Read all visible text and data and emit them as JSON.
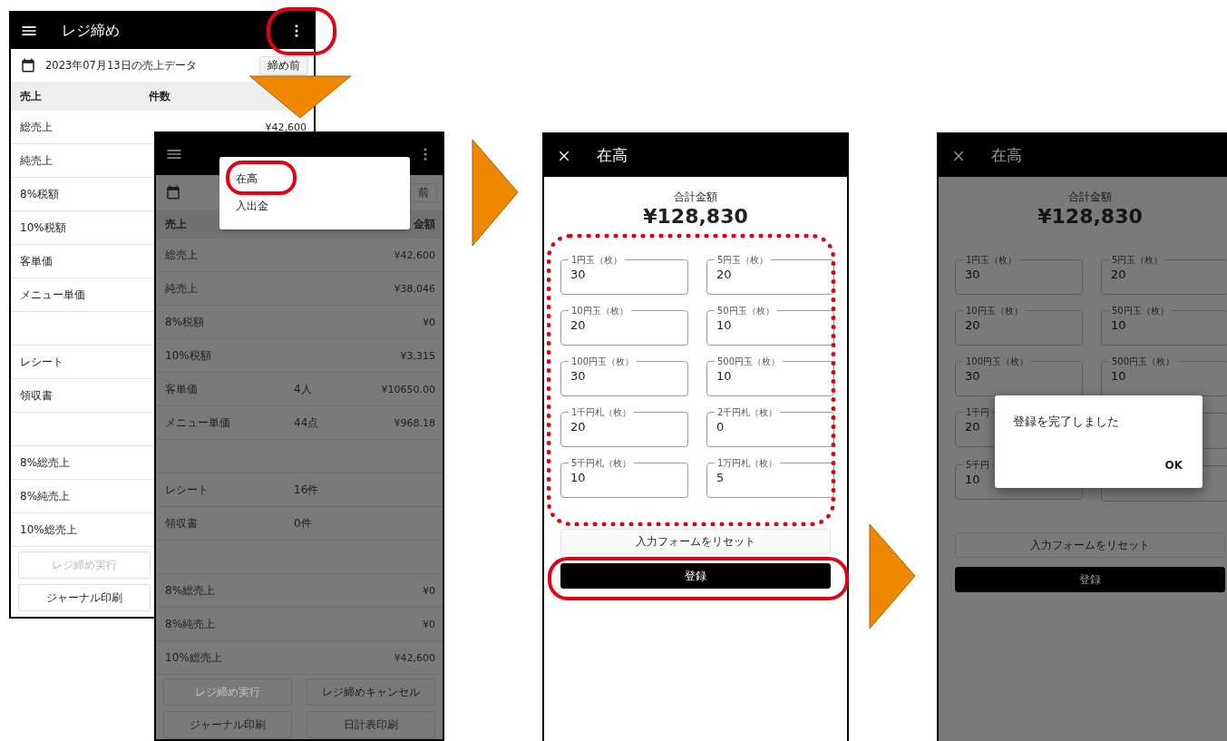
{
  "screens": [
    {
      "kind": "sales",
      "dimmed": false,
      "title": "レジ締め",
      "date": "2023年07月13日の売上データ",
      "status_button": "締め前",
      "header": {
        "label": "売上",
        "count": "件数"
      },
      "rows": [
        {
          "kind": "item",
          "label": "総売上",
          "amount": "¥42,600"
        },
        {
          "kind": "item",
          "label": "純売上"
        },
        {
          "kind": "item",
          "label": "8%税額"
        },
        {
          "kind": "item",
          "label": "10%税額"
        },
        {
          "kind": "item",
          "label": "客単価"
        },
        {
          "kind": "item",
          "label": "メニュー単価"
        },
        {
          "kind": "spacer"
        },
        {
          "kind": "item",
          "label": "レシート"
        },
        {
          "kind": "item",
          "label": "領収書"
        },
        {
          "kind": "spacer"
        },
        {
          "kind": "item",
          "label": "8%総売上"
        },
        {
          "kind": "item",
          "label": "8%純売上"
        },
        {
          "kind": "item",
          "label": "10%総売上"
        }
      ],
      "button_rows": [
        [
          {
            "label": "レジ締め実行",
            "disabled": true
          }
        ],
        [
          {
            "label": "ジャーナル印刷",
            "disabled": false
          }
        ]
      ]
    },
    {
      "kind": "sales",
      "dimmed": true,
      "status_button": "前",
      "header": {
        "label": "売上",
        "amount": "金額"
      },
      "rows": [
        {
          "kind": "item",
          "label": "総売上",
          "amount": "¥42,600"
        },
        {
          "kind": "item",
          "label": "純売上",
          "amount": "¥38,046"
        },
        {
          "kind": "item",
          "label": "8%税額",
          "amount": "¥0"
        },
        {
          "kind": "item",
          "label": "10%税額",
          "amount": "¥3,315"
        },
        {
          "kind": "item",
          "label": "客単価",
          "count": "4人",
          "amount": "¥10650.00"
        },
        {
          "kind": "item",
          "label": "メニュー単価",
          "count": "44点",
          "amount": "¥968.18"
        },
        {
          "kind": "spacer"
        },
        {
          "kind": "item",
          "label": "レシート",
          "count": "16件"
        },
        {
          "kind": "item",
          "label": "領収書",
          "count": "0件"
        },
        {
          "kind": "spacer"
        },
        {
          "kind": "item",
          "label": "8%総売上",
          "amount": "¥0"
        },
        {
          "kind": "item",
          "label": "8%純売上",
          "amount": "¥0"
        },
        {
          "kind": "item",
          "label": "10%総売上",
          "amount": "¥42,600"
        }
      ],
      "button_rows": [
        [
          {
            "label": "レジ締め実行",
            "disabled": true
          },
          {
            "label": "レジ締めキャンセル",
            "disabled": false
          }
        ],
        [
          {
            "label": "ジャーナル印刷",
            "disabled": false
          },
          {
            "label": "日計表印刷",
            "disabled": false
          }
        ]
      ],
      "menu": [
        {
          "label": "在高"
        },
        {
          "label": "入出金"
        }
      ]
    },
    {
      "kind": "stock",
      "dimmed": false,
      "title": "在高",
      "total_label": "合計金額",
      "total": "¥128,830",
      "fields": [
        {
          "label": "1円玉（枚）",
          "value": "30"
        },
        {
          "label": "5円玉（枚）",
          "value": "20"
        },
        {
          "label": "10円玉（枚）",
          "value": "20"
        },
        {
          "label": "50円玉（枚）",
          "value": "10"
        },
        {
          "label": "100円玉（枚）",
          "value": "30"
        },
        {
          "label": "500円玉（枚）",
          "value": "10"
        },
        {
          "label": "1千円札（枚）",
          "value": "20"
        },
        {
          "label": "2千円札（枚）",
          "value": "0"
        },
        {
          "label": "5千円札（枚）",
          "value": "10"
        },
        {
          "label": "1万円札（枚）",
          "value": "5"
        }
      ],
      "buttons": [
        {
          "label": "入力フォームをリセット",
          "kind": "outline"
        },
        {
          "label": "登録",
          "kind": "primary"
        }
      ]
    },
    {
      "kind": "stock",
      "dimmed": true,
      "title": "在高",
      "total_label": "合計金額",
      "total": "¥128,830",
      "fields": [
        {
          "label": "1円玉（枚）",
          "value": "30"
        },
        {
          "label": "5円玉（枚）",
          "value": "20"
        },
        {
          "label": "10円玉（枚）",
          "value": "20"
        },
        {
          "label": "50円玉（枚）",
          "value": "10"
        },
        {
          "label": "100円玉（枚）",
          "value": "30"
        },
        {
          "label": "500円玉（枚）",
          "value": "10"
        },
        {
          "label": "1千円",
          "value": "20"
        },
        {
          "covered": true
        },
        {
          "label": "5千円",
          "value": "10"
        },
        {
          "covered": true
        }
      ],
      "buttons": [
        {
          "label": "入力フォームをリセット",
          "kind": "outline"
        },
        {
          "label": "登録",
          "kind": "primary"
        }
      ],
      "dialog": {
        "message": "登録を完了しました",
        "button": "OK"
      }
    }
  ]
}
